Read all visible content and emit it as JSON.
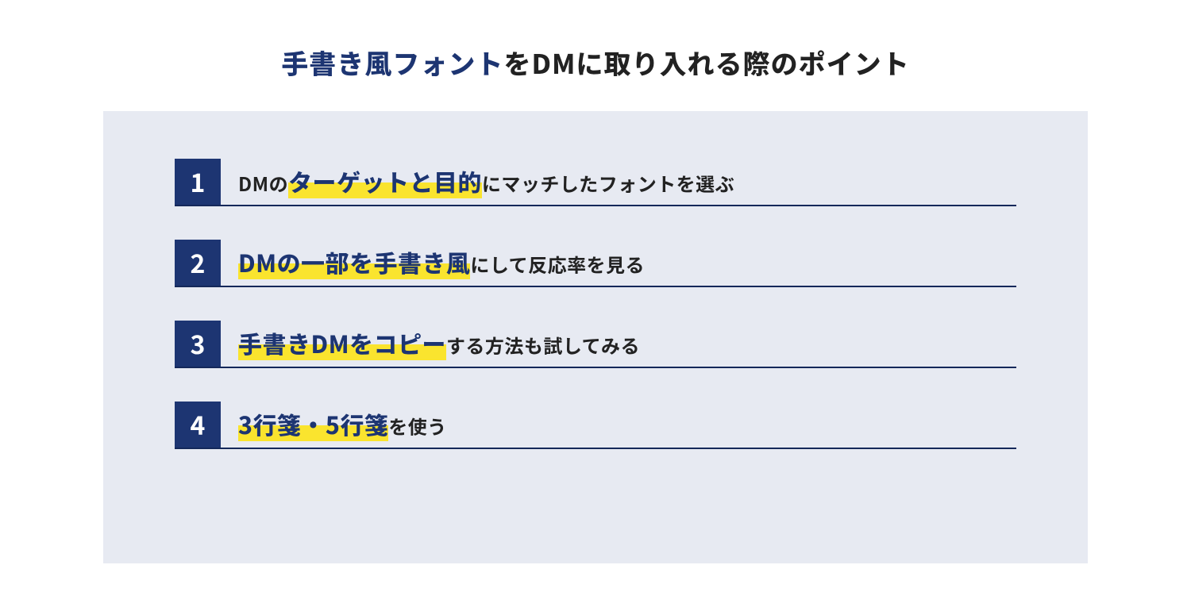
{
  "heading": {
    "accent": "手書き風フォント",
    "rest": "をDMに取り入れる際のポイント"
  },
  "items": [
    {
      "num": "1",
      "pre": "DMの",
      "highlight": "ターゲットと目的",
      "post": "にマッチしたフォントを選ぶ"
    },
    {
      "num": "2",
      "pre": "",
      "highlight": "DMの一部を手書き風",
      "post": "にして反応率を見る"
    },
    {
      "num": "3",
      "pre": "",
      "highlight": "手書きDMをコピー",
      "post": "する方法も試してみる"
    },
    {
      "num": "4",
      "pre": "",
      "highlight": "3行箋・5行箋",
      "post": "を使う"
    }
  ]
}
